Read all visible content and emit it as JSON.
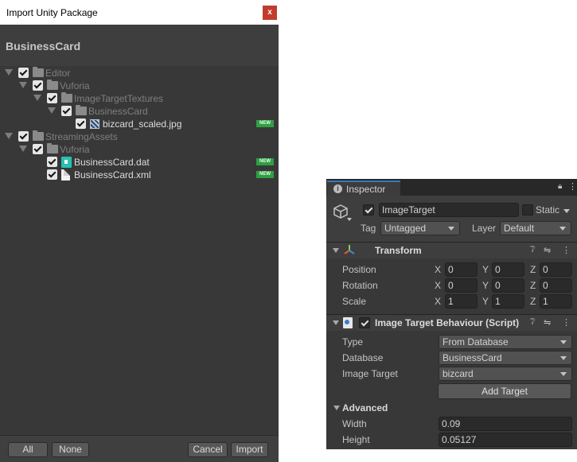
{
  "import_window": {
    "title": "Import Unity Package",
    "close_glyph": "x",
    "package_name": "BusinessCard",
    "tree": [
      {
        "label": "Editor",
        "depth": 0,
        "kind": "folder",
        "has_arrow": true,
        "is_new": false
      },
      {
        "label": "Vuforia",
        "depth": 1,
        "kind": "folder",
        "has_arrow": true,
        "is_new": false
      },
      {
        "label": "ImageTargetTextures",
        "depth": 2,
        "kind": "folder",
        "has_arrow": true,
        "is_new": false
      },
      {
        "label": "BusinessCard",
        "depth": 3,
        "kind": "folder",
        "has_arrow": true,
        "is_new": false
      },
      {
        "label": "bizcard_scaled.jpg",
        "depth": 4,
        "kind": "image",
        "has_arrow": false,
        "is_new": true
      },
      {
        "label": "StreamingAssets",
        "depth": 0,
        "kind": "folder",
        "has_arrow": true,
        "is_new": false
      },
      {
        "label": "Vuforia",
        "depth": 1,
        "kind": "folder",
        "has_arrow": true,
        "is_new": false
      },
      {
        "label": "BusinessCard.dat",
        "depth": 2,
        "kind": "dat",
        "has_arrow": false,
        "is_new": true
      },
      {
        "label": "BusinessCard.xml",
        "depth": 2,
        "kind": "xml",
        "has_arrow": false,
        "is_new": true
      }
    ],
    "new_badge": "NEW",
    "footer": {
      "all": "All",
      "none": "None",
      "cancel": "Cancel",
      "import": "Import"
    }
  },
  "inspector": {
    "tab_label": "Inspector",
    "tab_icon": "info-icon",
    "game_object": {
      "active": true,
      "name": "ImageTarget",
      "static_label": "Static",
      "tag_label": "Tag",
      "tag_value": "Untagged",
      "layer_label": "Layer",
      "layer_value": "Default"
    },
    "transform": {
      "title": "Transform",
      "rows": [
        {
          "label": "Position",
          "x": "0",
          "y": "0",
          "z": "0"
        },
        {
          "label": "Rotation",
          "x": "0",
          "y": "0",
          "z": "0"
        },
        {
          "label": "Scale",
          "x": "1",
          "y": "1",
          "z": "1"
        }
      ],
      "axis_labels": {
        "x": "X",
        "y": "Y",
        "z": "Z"
      }
    },
    "image_target_behaviour": {
      "title": "Image Target Behaviour (Script)",
      "enabled": true,
      "type_label": "Type",
      "type_value": "From Database",
      "database_label": "Database",
      "database_value": "BusinessCard",
      "image_target_label": "Image Target",
      "image_target_value": "bizcard",
      "add_target_button": "Add Target",
      "advanced_label": "Advanced",
      "width_label": "Width",
      "width_value": "0.09",
      "height_label": "Height",
      "height_value": "0.05127"
    }
  },
  "colors": {
    "panel_bg": "#383838",
    "header_bg": "#3e3e3e",
    "new_badge": "#2ea043",
    "close_button": "#c23c2d",
    "tab_accent": "#3a79bb"
  }
}
